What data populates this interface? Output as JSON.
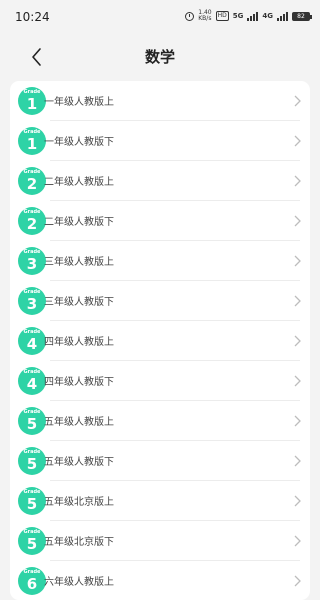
{
  "status": {
    "time": "10:24",
    "speed_value": "1.40",
    "speed_unit": "KB/s",
    "hd": "HD",
    "net1": "5G",
    "net2": "4G",
    "battery": "82"
  },
  "header": {
    "title": "数学"
  },
  "grades": [
    {
      "badge_word": "Grade",
      "num": "1",
      "label": "一年级人教版上"
    },
    {
      "badge_word": "Grade",
      "num": "1",
      "label": "一年级人教版下"
    },
    {
      "badge_word": "Grade",
      "num": "2",
      "label": "二年级人教版上"
    },
    {
      "badge_word": "Grade",
      "num": "2",
      "label": "二年级人教版下"
    },
    {
      "badge_word": "Grade",
      "num": "3",
      "label": "三年级人教版上"
    },
    {
      "badge_word": "Grade",
      "num": "3",
      "label": "三年级人教版下"
    },
    {
      "badge_word": "Grade",
      "num": "4",
      "label": "四年级人教版上"
    },
    {
      "badge_word": "Grade",
      "num": "4",
      "label": "四年级人教版下"
    },
    {
      "badge_word": "Grade",
      "num": "5",
      "label": "五年级人教版上"
    },
    {
      "badge_word": "Grade",
      "num": "5",
      "label": "五年级人教版下"
    },
    {
      "badge_word": "Grade",
      "num": "5",
      "label": "五年级北京版上"
    },
    {
      "badge_word": "Grade",
      "num": "5",
      "label": "五年级北京版下"
    },
    {
      "badge_word": "Grade",
      "num": "6",
      "label": "六年级人教版上"
    }
  ],
  "colors": {
    "badge": "#2ed3a6"
  }
}
